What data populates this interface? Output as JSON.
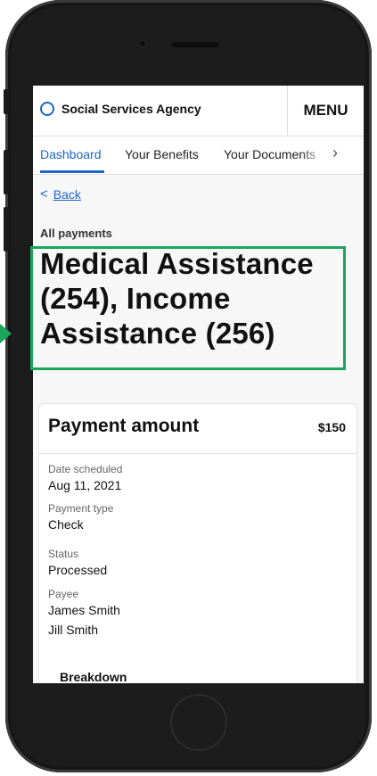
{
  "header": {
    "agency_name": "Social Services Agency",
    "menu_label": "MENU",
    "brand_color": "#1e66c7"
  },
  "tabs": [
    {
      "label": "Dashboard",
      "active": true
    },
    {
      "label": "Your Benefits",
      "active": false
    },
    {
      "label": "Your Documents",
      "active": false
    }
  ],
  "tabs_more_icon": "chevron-right-icon",
  "back": {
    "label": "Back",
    "icon": "chevron-left-icon"
  },
  "page": {
    "eyebrow": "All payments",
    "title": "Medical Assistance (254), Income Assistance (256)"
  },
  "annotation": {
    "color": "#1aa55a"
  },
  "payment_card": {
    "title": "Payment amount",
    "amount": "$150",
    "fields": [
      {
        "label": "Date scheduled",
        "values": [
          "Aug 11, 2021"
        ]
      },
      {
        "label": "Payment type",
        "values": [
          "Check"
        ]
      },
      {
        "label": "Status",
        "values": [
          "Processed"
        ]
      },
      {
        "label": "Payee",
        "values": [
          "James Smith",
          "Jill Smith"
        ]
      }
    ],
    "breakdown_label": "Breakdown"
  }
}
